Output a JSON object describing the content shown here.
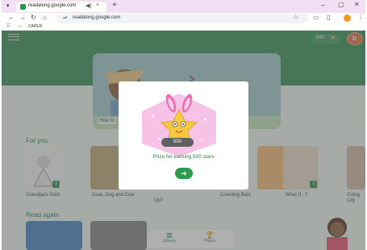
{
  "browser": {
    "tab_title": "readalong.google.com",
    "tab_audio_icon": "speaker-icon",
    "tab_close": "×",
    "new_tab": "+",
    "url": "readalong.google.com",
    "bookmark_name": "CAPER",
    "window_minimize": "–",
    "window_maximize": "▢",
    "window_close": "✕"
  },
  "app": {
    "stars_count": "500",
    "avatar_letter": "b",
    "hero_label": "How to",
    "sections": {
      "for_you": "For you",
      "read_again": "Read again"
    },
    "cards": [
      {
        "title": "Grandpa's Gold",
        "badge": "2"
      },
      {
        "title": "Goat, Dog and Cow",
        "badge": ""
      },
      {
        "title": "Up?",
        "badge": ""
      },
      {
        "title": "Counting Bats",
        "badge": "2"
      },
      {
        "title": "What If...?",
        "badge": "2"
      },
      {
        "title": "Going City",
        "badge": ""
      }
    ],
    "bottom_nav": [
      {
        "label": "Library",
        "icon": "library-icon"
      },
      {
        "label": "Prizes",
        "icon": "trophy-icon"
      }
    ]
  },
  "modal": {
    "prize_number": "500",
    "prize_text": "Prize for earning 500 stars",
    "button_icon": "arrow-right-icon",
    "button_symbol": "➔"
  },
  "colors": {
    "app_green": "#2f8a4e",
    "tab_bar": "#f2dff4",
    "prize_pink": "#f6c3e7",
    "star_yellow": "#f5c842"
  }
}
